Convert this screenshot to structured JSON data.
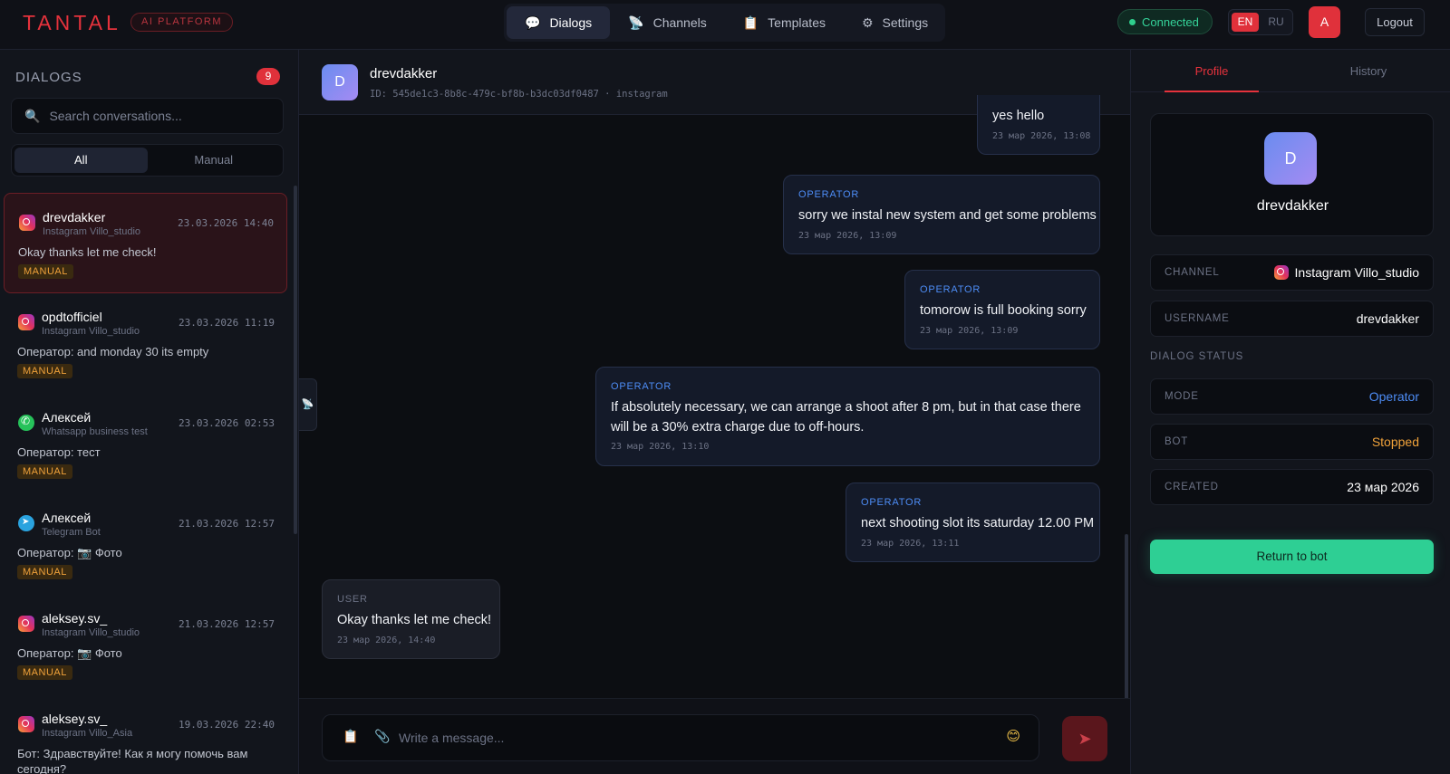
{
  "header": {
    "logo": "TANTAL",
    "platform_badge": "AI PLATFORM",
    "nav": [
      {
        "label": "Dialogs",
        "icon": "💬"
      },
      {
        "label": "Channels",
        "icon": "📡"
      },
      {
        "label": "Templates",
        "icon": "📋"
      },
      {
        "label": "Settings",
        "icon": "⚙"
      }
    ],
    "connection_status": "Connected",
    "languages": [
      "EN",
      "RU"
    ],
    "user_initial": "A",
    "logout_label": "Logout"
  },
  "sidebar": {
    "title": "DIALOGS",
    "count": "9",
    "search_placeholder": "Search conversations...",
    "filters": [
      "All",
      "Manual"
    ],
    "dialogs": [
      {
        "name": "drevdakker",
        "channel": "Instagram Villo_studio",
        "channel_type": "instagram",
        "time": "23.03.2026 14:40",
        "last_message": "Okay thanks let me check!",
        "tag": "MANUAL"
      },
      {
        "name": "opdtofficiel",
        "channel": "Instagram Villo_studio",
        "channel_type": "instagram",
        "time": "23.03.2026 11:19",
        "last_message": "Оператор: and monday 30 its empty",
        "tag": "MANUAL"
      },
      {
        "name": "Алексей",
        "channel": "Whatsapp business test",
        "channel_type": "whatsapp",
        "time": "23.03.2026 02:53",
        "last_message": "Оператор: тест",
        "tag": "MANUAL"
      },
      {
        "name": "Алексей",
        "channel": "Telegram Bot",
        "channel_type": "telegram",
        "time": "21.03.2026 12:57",
        "last_message": "Оператор: 📷 Фото",
        "tag": "MANUAL"
      },
      {
        "name": "aleksey.sv_",
        "channel": "Instagram Villo_studio",
        "channel_type": "instagram",
        "time": "21.03.2026 12:57",
        "last_message": "Оператор: 📷 Фото",
        "tag": "MANUAL"
      },
      {
        "name": "aleksey.sv_",
        "channel": "Instagram Villo_Asia",
        "channel_type": "instagram",
        "time": "19.03.2026 22:40",
        "last_message": "Бот: Здравствуйте! Как я могу помочь вам сегодня?",
        "tag": ""
      }
    ]
  },
  "chat": {
    "avatar_initial": "D",
    "title": "drevdakker",
    "meta": "ID: 545de1c3-8b8c-479c-bf8b-b3dc03df0487 · instagram",
    "collapse_icon": "📡",
    "messages": [
      {
        "role": "",
        "text": "yes hello",
        "time": "23 мар 2026, 13:08"
      },
      {
        "role": "OPERATOR",
        "text": "sorry we instal new system and get some problems",
        "time": "23 мар 2026, 13:09"
      },
      {
        "role": "OPERATOR",
        "text": "tomorow is full booking sorry",
        "time": "23 мар 2026, 13:09"
      },
      {
        "role": "OPERATOR",
        "text": "If absolutely necessary, we can arrange a shoot after 8 pm, but in that case there will be a 30% extra charge due to off-hours.",
        "time": "23 мар 2026, 13:10"
      },
      {
        "role": "OPERATOR",
        "text": "next shooting slot its saturday 12.00 PM",
        "time": "23 мар 2026, 13:11"
      },
      {
        "role": "USER",
        "text": "Okay thanks let me check!",
        "time": "23 мар 2026, 14:40"
      }
    ],
    "composer_placeholder": "Write a message...",
    "icons": {
      "template": "📋",
      "attach": "📎",
      "emoji": "😊",
      "send": "➤"
    }
  },
  "profile": {
    "tabs": [
      "Profile",
      "History"
    ],
    "avatar_initial": "D",
    "name": "drevdakker",
    "channel_label": "CHANNEL",
    "channel_value": "Instagram Villo_studio",
    "username_label": "USERNAME",
    "username_value": "drevdakker",
    "status_section": "DIALOG STATUS",
    "mode_label": "MODE",
    "mode_value": "Operator",
    "bot_label": "BOT",
    "bot_value": "Stopped",
    "created_label": "CREATED",
    "created_value": "23 мар 2026",
    "return_button": "Return to bot",
    "colors": {
      "mode": "#4d8cf5",
      "bot": "#f0a23a",
      "accent": "#e5323c",
      "success": "#2ecf94"
    }
  }
}
